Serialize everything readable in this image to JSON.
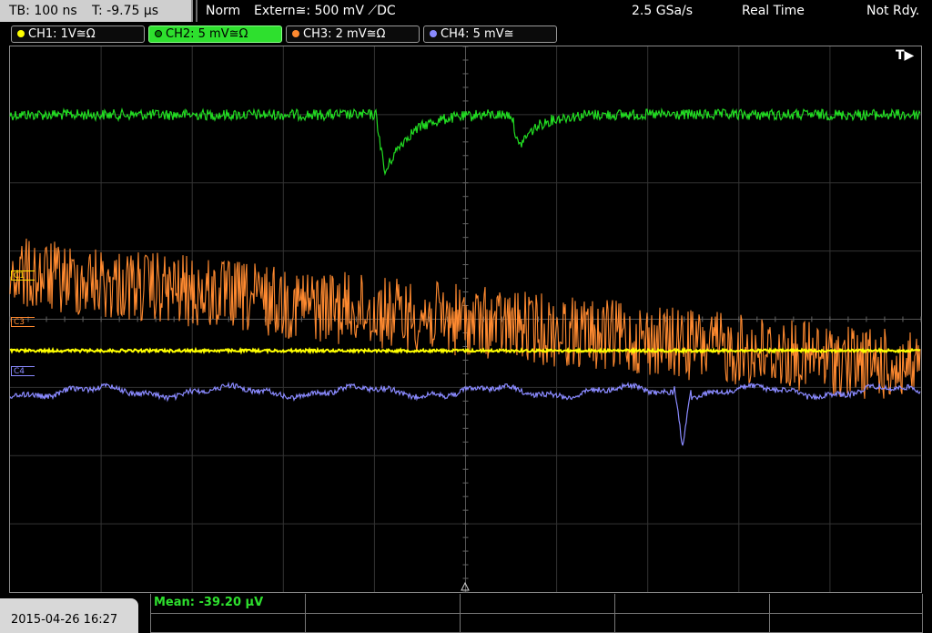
{
  "top_bar": {
    "timebase": "TB: 100 ns",
    "trigger_time": "T: -9.75 µs",
    "mode": "Norm",
    "trigger_source": "Extern≅: 500 mV ⟋DC",
    "sample_rate": "2.5 GSa/s",
    "acq_mode": "Real Time",
    "status": "Not Rdy."
  },
  "channels": [
    {
      "label": "CH1: 1V≅Ω",
      "color": "#ffff00",
      "active": false
    },
    {
      "label": "CH2: 5 mV≅Ω",
      "color": "#22dd22",
      "active": true
    },
    {
      "label": "CH3: 2 mV≅Ω",
      "color": "#ff8a30",
      "active": false
    },
    {
      "label": "CH4: 5 mV≅",
      "color": "#8a8aff",
      "active": false
    }
  ],
  "markers": {
    "c1": "C1",
    "c3": "C3",
    "c4": "C4"
  },
  "trigger_indicator": "T▶",
  "measurement": {
    "label": "Mean: -39.20 µV"
  },
  "datetime": "2015-04-26 16:27",
  "colors": {
    "ch1": "#ffff00",
    "ch2": "#22dd22",
    "ch3": "#ff8a30",
    "ch4": "#8a8aff",
    "grid": "#3a3a3a"
  }
}
